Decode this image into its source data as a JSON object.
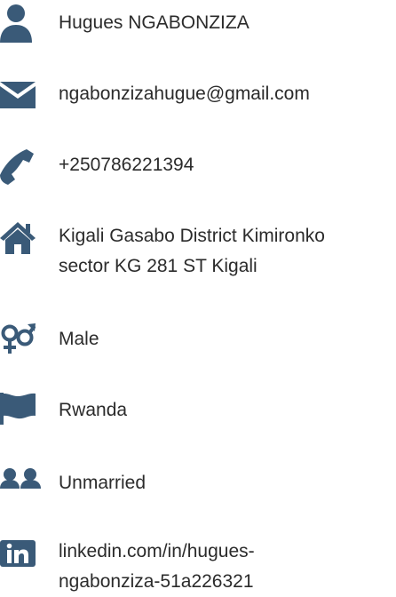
{
  "icon_color": "#3a5a78",
  "contact": [
    {
      "icon": "user-icon",
      "text": "Hugues NGABONZIZA"
    },
    {
      "icon": "envelope-icon",
      "text": "ngabonzizahugue@gmail.com"
    },
    {
      "icon": "phone-icon",
      "text": "+250786221394"
    },
    {
      "icon": "home-icon",
      "lines": [
        "Kigali Gasabo District Kimironko",
        "sector KG 281 ST Kigali"
      ]
    },
    {
      "icon": "gender-icon",
      "text": "Male"
    },
    {
      "icon": "flag-icon",
      "text": "Rwanda"
    },
    {
      "icon": "users-icon",
      "text": "Unmarried"
    },
    {
      "icon": "linkedin-icon",
      "lines": [
        "linkedin.com/in/hugues-",
        "ngabonziza-51a226321"
      ]
    }
  ]
}
